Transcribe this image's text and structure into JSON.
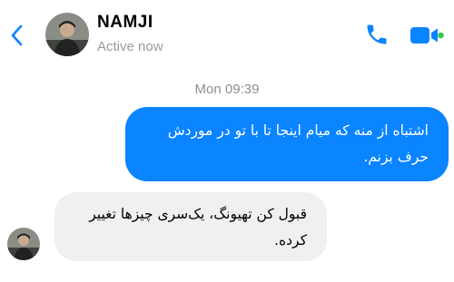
{
  "header": {
    "back_icon": "chevron-left-icon",
    "contact_name": "NAMJI",
    "status": "Active now",
    "call_icon": "phone-icon",
    "video_icon": "video-camera-icon",
    "active_dot_color": "#31c94a",
    "accent_color": "#0a84ff"
  },
  "conversation": {
    "timestamp": "Mon 09:39",
    "messages": [
      {
        "direction": "outgoing",
        "text": "اشتباه از منه که میام اینجا تا با تو در موردش حرف بزنم."
      },
      {
        "direction": "incoming",
        "text": "قبول کن تهیونگ، یک‌سری چیزها تغییر کرده."
      }
    ]
  }
}
